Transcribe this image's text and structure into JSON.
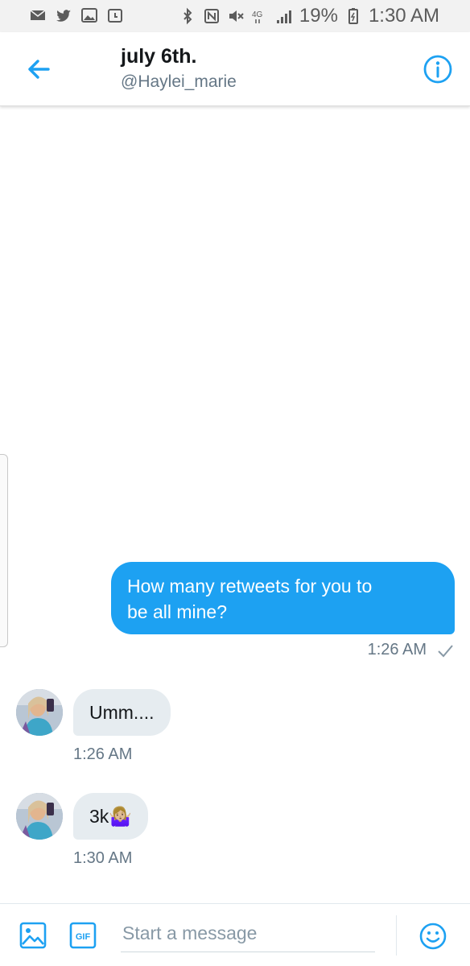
{
  "status_bar": {
    "left_icons": [
      "mail-icon",
      "twitter-bird-icon",
      "image-icon",
      "calendar-icon"
    ],
    "right_icons": [
      "bluetooth-icon",
      "nfc-icon",
      "mute-icon",
      "4g-lte-icon",
      "signal-icon"
    ],
    "battery_percent": "19%",
    "time": "1:30 AM"
  },
  "header": {
    "title": "july 6th.",
    "handle": "@Haylei_marie",
    "back_icon": "back-arrow-icon",
    "info_icon": "info-icon"
  },
  "messages": [
    {
      "direction": "outgoing",
      "text_line1": "How many retweets for you to",
      "text_line2": "be all mine?",
      "time": "1:26 AM",
      "status_icon": "check-icon"
    },
    {
      "direction": "incoming",
      "text": "Umm....",
      "time": "1:26 AM"
    },
    {
      "direction": "incoming",
      "text": "3k🤷🏼‍♀️",
      "time": "1:30 AM"
    }
  ],
  "composer": {
    "placeholder": "Start a message",
    "media_icon": "image-icon",
    "gif_label": "GIF",
    "emoji_icon": "smiley-icon"
  },
  "colors": {
    "accent": "#1da1f2",
    "incoming_bubble": "#e6ecf0",
    "secondary_text": "#657786"
  }
}
